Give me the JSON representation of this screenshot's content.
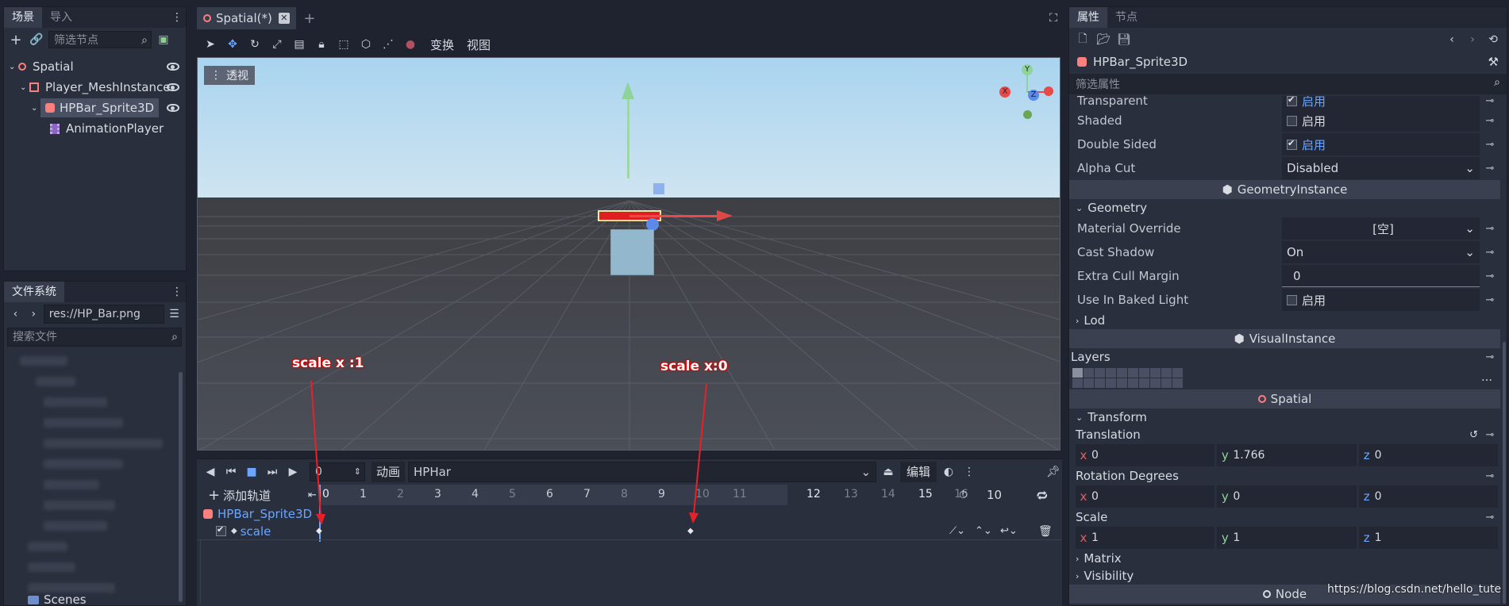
{
  "scene_dock": {
    "tabs": [
      "场景",
      "导入"
    ],
    "filter_placeholder": "筛选节点",
    "tree": [
      {
        "label": "Spatial",
        "depth": 0
      },
      {
        "label": "Player_MeshInstance",
        "depth": 1
      },
      {
        "label": "HPBar_Sprite3D",
        "depth": 2
      },
      {
        "label": "AnimationPlayer",
        "depth": 3
      }
    ]
  },
  "filesystem": {
    "tab": "文件系统",
    "path": "res://HP_Bar.png",
    "search_placeholder": "搜索文件",
    "last_item": "Scenes"
  },
  "editor": {
    "scene_tab": "Spatial(*)",
    "toolbar_menus": [
      "变换",
      "视图"
    ],
    "viewport_label": "透视",
    "gizmo_axes": {
      "y": "Y",
      "x": "X",
      "z": "Z"
    }
  },
  "annotations": {
    "left": "scale x :1",
    "right": "scale x:0"
  },
  "animation": {
    "frame": "0",
    "anim_label": "动画",
    "anim_name": "HPHar",
    "edit_label": "编辑",
    "add_track": "添加轨道",
    "ticks": [
      "0",
      "1",
      "2",
      "3",
      "4",
      "5",
      "6",
      "7",
      "8",
      "9",
      "10",
      "11",
      "12",
      "13",
      "14",
      "15",
      "16"
    ],
    "length": "10",
    "track_node": "HPBar_Sprite3D",
    "track_prop": "scale"
  },
  "inspector": {
    "tabs": [
      "属性",
      "节点"
    ],
    "node_name": "HPBar_Sprite3D",
    "filter_placeholder": "筛选属性",
    "props_top": [
      {
        "label": "Transparent",
        "type": "check",
        "checked": true,
        "value": "启用"
      },
      {
        "label": "Shaded",
        "type": "check",
        "checked": false,
        "value": "启用"
      },
      {
        "label": "Double Sided",
        "type": "check",
        "checked": true,
        "value": "启用"
      },
      {
        "label": "Alpha Cut",
        "type": "enum",
        "value": "Disabled"
      }
    ],
    "geometry_section": "GeometryInstance",
    "geometry_group": "Geometry",
    "geometry_props": [
      {
        "label": "Material Override",
        "type": "center",
        "value": "[空]"
      },
      {
        "label": "Cast Shadow",
        "type": "enum",
        "value": "On"
      },
      {
        "label": "Extra Cull Margin",
        "type": "num",
        "value": "0"
      },
      {
        "label": "Use In Baked Light",
        "type": "check",
        "checked": false,
        "value": "启用"
      }
    ],
    "lod_group": "Lod",
    "visual_section": "VisualInstance",
    "layers_label": "Layers",
    "spatial_section": "Spatial",
    "transform_group": "Transform",
    "translation_label": "Translation",
    "translation": {
      "x": "0",
      "y": "1.766",
      "z": "0"
    },
    "rotation_label": "Rotation Degrees",
    "rotation": {
      "x": "0",
      "y": "0",
      "z": "0"
    },
    "scale_label": "Scale",
    "scale": {
      "x": "1",
      "y": "1",
      "z": "1"
    },
    "matrix_group": "Matrix",
    "visibility_group": "Visibility",
    "node_section": "Node"
  },
  "watermark": "https://blog.csdn.net/hello_tute"
}
